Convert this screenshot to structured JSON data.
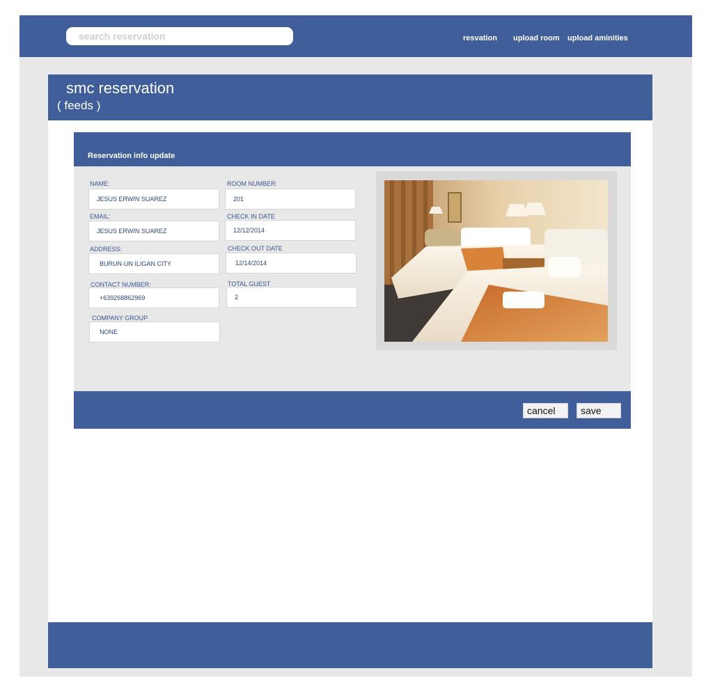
{
  "header": {
    "search_placeholder": "search reservation",
    "nav": [
      "resvation",
      "upload room",
      "upload aminities"
    ]
  },
  "app": {
    "title": "smc reservation",
    "subtitle": "( feeds )"
  },
  "panel": {
    "title": "Reservation info update",
    "fields": {
      "name": {
        "label": "NAME:",
        "value": "JESUS ERWIN SUAREZ"
      },
      "email": {
        "label": "EMAIL:",
        "value": "JESUS ERWIN SUAREZ"
      },
      "address": {
        "label": "ADDRESS:",
        "value": "BURUN-UN ILIGAN CITY"
      },
      "contact": {
        "label": "CONTACT NUMBER:",
        "value": "+639268862969"
      },
      "company": {
        "label": "COMPANY GROUP",
        "value": "NONE"
      },
      "room": {
        "label": "ROOM NUMBER:",
        "value": "201"
      },
      "checkin": {
        "label": "CHECK IN DATE",
        "value": "12/12/2014"
      },
      "checkout": {
        "label": "CHECK OUT DATE",
        "value": "12/14/2014"
      },
      "guests": {
        "label": "TOTAL GUEST",
        "value": "2"
      }
    },
    "cancel_label": "cancel",
    "save_label": "save"
  },
  "colors": {
    "brand": "#405e99",
    "background": "#e8e8e8"
  }
}
